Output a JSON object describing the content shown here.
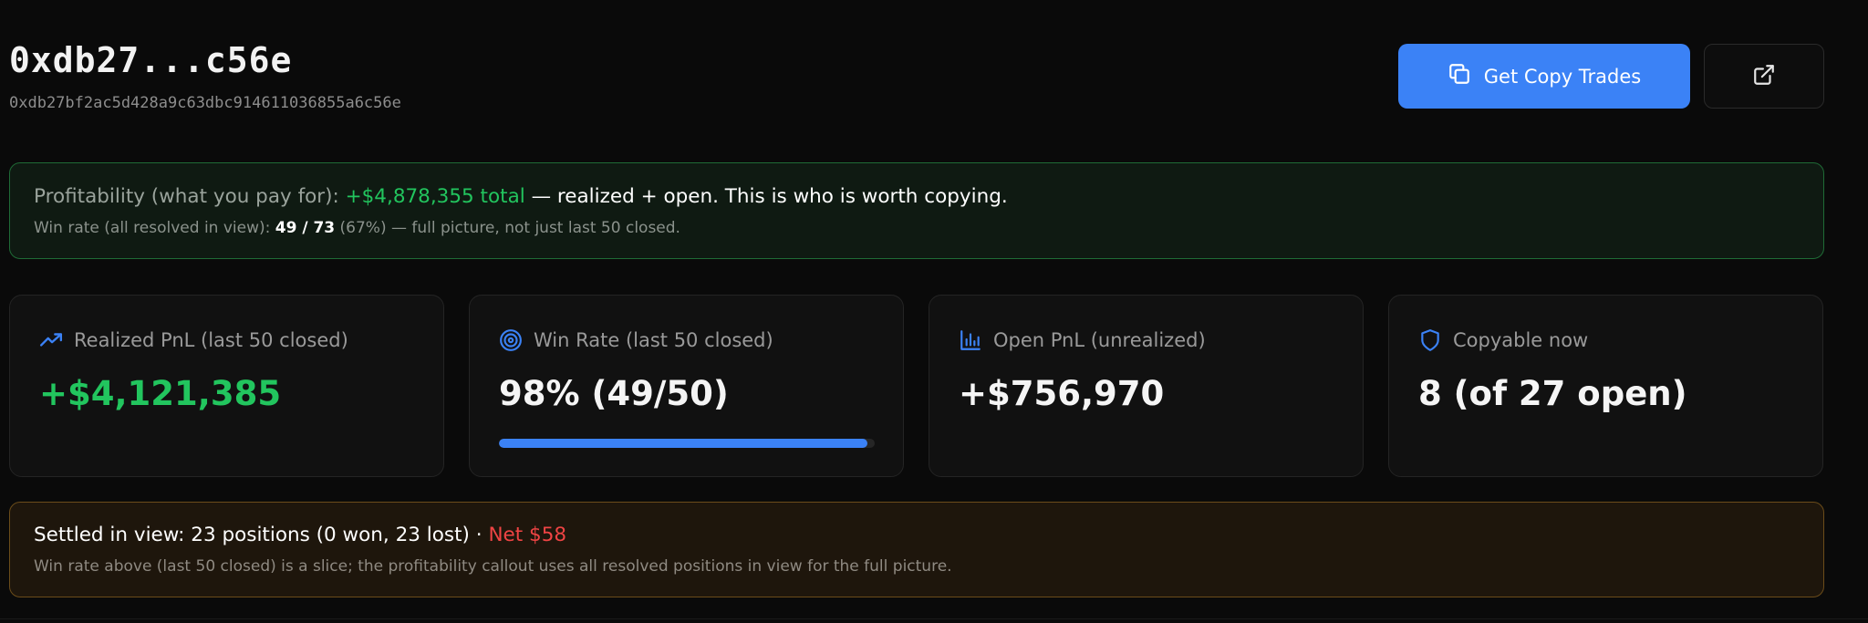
{
  "header": {
    "title": "0xdb27...c56e",
    "address": "0xdb27bf2ac5d428a9c63dbc914611036855a6c56e",
    "copy_button_label": "Get Copy Trades",
    "copy_button_icon": "copy-icon",
    "external_button_icon": "external-link-icon"
  },
  "profitability": {
    "label": "Profitability (what you pay for):",
    "total": "+$4,878,355 total",
    "rest": "— realized + open. This is who is worth copying.",
    "winrate_label": "Win rate (all resolved in view):",
    "winrate_value": "49 / 73",
    "winrate_rest": "(67%) — full picture, not just last 50 closed."
  },
  "cards": [
    {
      "icon": "trending-up-icon",
      "label": "Realized PnL (last 50 closed)",
      "value": "+$4,121,385"
    },
    {
      "icon": "target-icon",
      "label": "Win Rate (last 50 closed)",
      "value": "98% (49/50)",
      "progress": 0.98
    },
    {
      "icon": "bar-chart-icon",
      "label": "Open PnL (unrealized)",
      "value": "+$756,970"
    },
    {
      "icon": "shield-icon",
      "label": "Copyable now",
      "value": "8 (of 27 open)"
    }
  ],
  "settled": {
    "summary": "Settled in view: 23 positions (0 won, 23 lost) ·",
    "net": "Net $58",
    "note": "Win rate above (last 50 closed) is a slice; the profitability callout uses all resolved positions in view for the full picture."
  },
  "colors": {
    "accent": "#3b82f6",
    "positive": "#22c55e",
    "negative": "#ef4444",
    "background": "#0a0a0a"
  }
}
